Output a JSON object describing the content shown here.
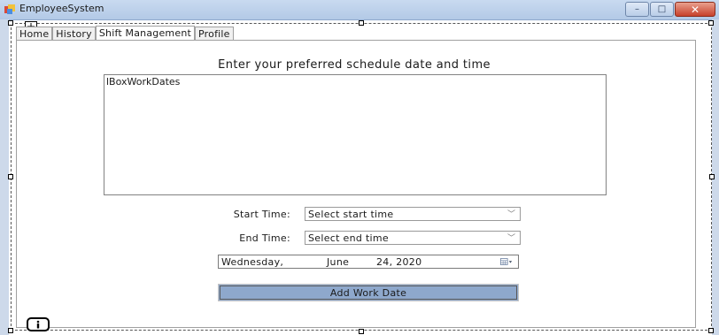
{
  "window": {
    "title": "EmployeeSystem",
    "close_glyph": "✕",
    "min_glyph": "–",
    "max_glyph": "□"
  },
  "tabs": [
    {
      "label": "Home"
    },
    {
      "label": "History"
    },
    {
      "label": "Shift Management"
    },
    {
      "label": "Profile"
    }
  ],
  "active_tab": "Shift Management",
  "main": {
    "heading": "Enter your preferred schedule date and time",
    "listbox_name": "lBoxWorkDates",
    "start_label": "Start Time:",
    "start_placeholder": "Select start time",
    "end_label": "End Time:",
    "end_placeholder": "Select end time",
    "date": {
      "weekday": "Wednesday,",
      "month": "June",
      "day_year": "24, 2020"
    },
    "add_button": "Add Work Date"
  },
  "icons": {
    "app": "app-window-icon",
    "calendar": "calendar-icon",
    "tray": "info-icon",
    "dropdown": "chevron-down-icon"
  },
  "colors": {
    "title_bar": "#c9daf0",
    "close_button": "#c7402b",
    "add_button": "#8ea8cc"
  }
}
